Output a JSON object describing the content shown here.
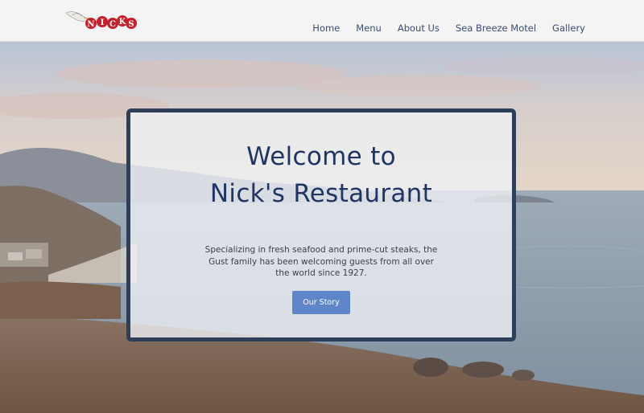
{
  "brand": {
    "logo_text": "NICKS"
  },
  "nav": {
    "items": [
      {
        "label": "Home"
      },
      {
        "label": "Menu"
      },
      {
        "label": "About Us"
      },
      {
        "label": "Sea Breeze Motel"
      },
      {
        "label": "Gallery"
      }
    ]
  },
  "hero": {
    "title_line1": "Welcome to",
    "title_line2": "Nick's Restaurant",
    "description": "Specializing in fresh seafood and prime-cut steaks, the Gust family has been welcoming guests from all over the world since 1927.",
    "button_label": "Our Story"
  },
  "colors": {
    "header_bg": "#f4f4f4",
    "nav_text": "#3a4d72",
    "title": "#1f3563",
    "card_border": "#2e3f5c",
    "button_bg": "#5f86c9",
    "logo_red": "#c8202a"
  }
}
